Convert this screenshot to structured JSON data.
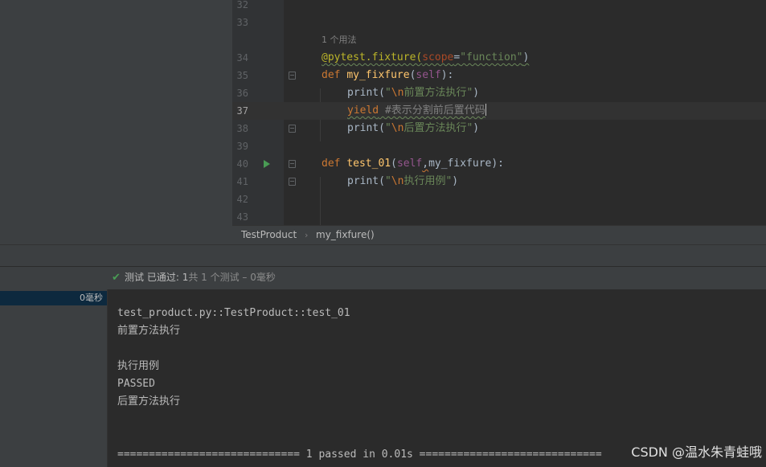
{
  "editor": {
    "line_numbers": [
      "32",
      "33",
      "34",
      "35",
      "36",
      "37",
      "38",
      "39",
      "40",
      "41",
      "42",
      "43"
    ],
    "usage_hint": "1 个用法",
    "code": {
      "l34_deco": "@pytest.fixture(",
      "l34_param": "scope",
      "l34_eq": "=",
      "l34_str": "\"function\"",
      "l34_close": ")",
      "l35_def": "def ",
      "l35_fn": "my_fixfure",
      "l35_open": "(",
      "l35_self": "self",
      "l35_close": "):",
      "l36_print": "print(",
      "l36_q": "\"",
      "l36_esc": "\\n",
      "l36_str": "前置方法执行\"",
      "l36_close": ")",
      "l37_yield": "yield",
      "l37_cmt": " #表示分割前后置代码",
      "l38_print": "print(",
      "l38_q": "\"",
      "l38_esc": "\\n",
      "l38_str": "后置方法执行\"",
      "l38_close": ")",
      "l40_def": "def ",
      "l40_fn": "test_01",
      "l40_open": "(",
      "l40_self": "self",
      "l40_comma": ",",
      "l40_arg": "my_fixfure",
      "l40_close": "):",
      "l41_print": "print(",
      "l41_q": "\"",
      "l41_esc": "\\n",
      "l41_str": "执行用例\"",
      "l41_close": ")"
    }
  },
  "breadcrumb": {
    "class": "TestProduct",
    "separator": "›",
    "method": "my_fixfure()"
  },
  "status_bar": {
    "label": "测试 已通过: ",
    "passed": "1",
    "total": "共 1 个测试 – 0毫秒"
  },
  "test_tree": {
    "time": "0毫秒"
  },
  "console": {
    "lines": [
      "test_product.py::TestProduct::test_01",
      "前置方法执行",
      "",
      "执行用例",
      "PASSED",
      "后置方法执行",
      "",
      "",
      "============================= 1 passed in 0.01s ============================="
    ]
  },
  "watermark": "CSDN @温水朱青蛙哦"
}
